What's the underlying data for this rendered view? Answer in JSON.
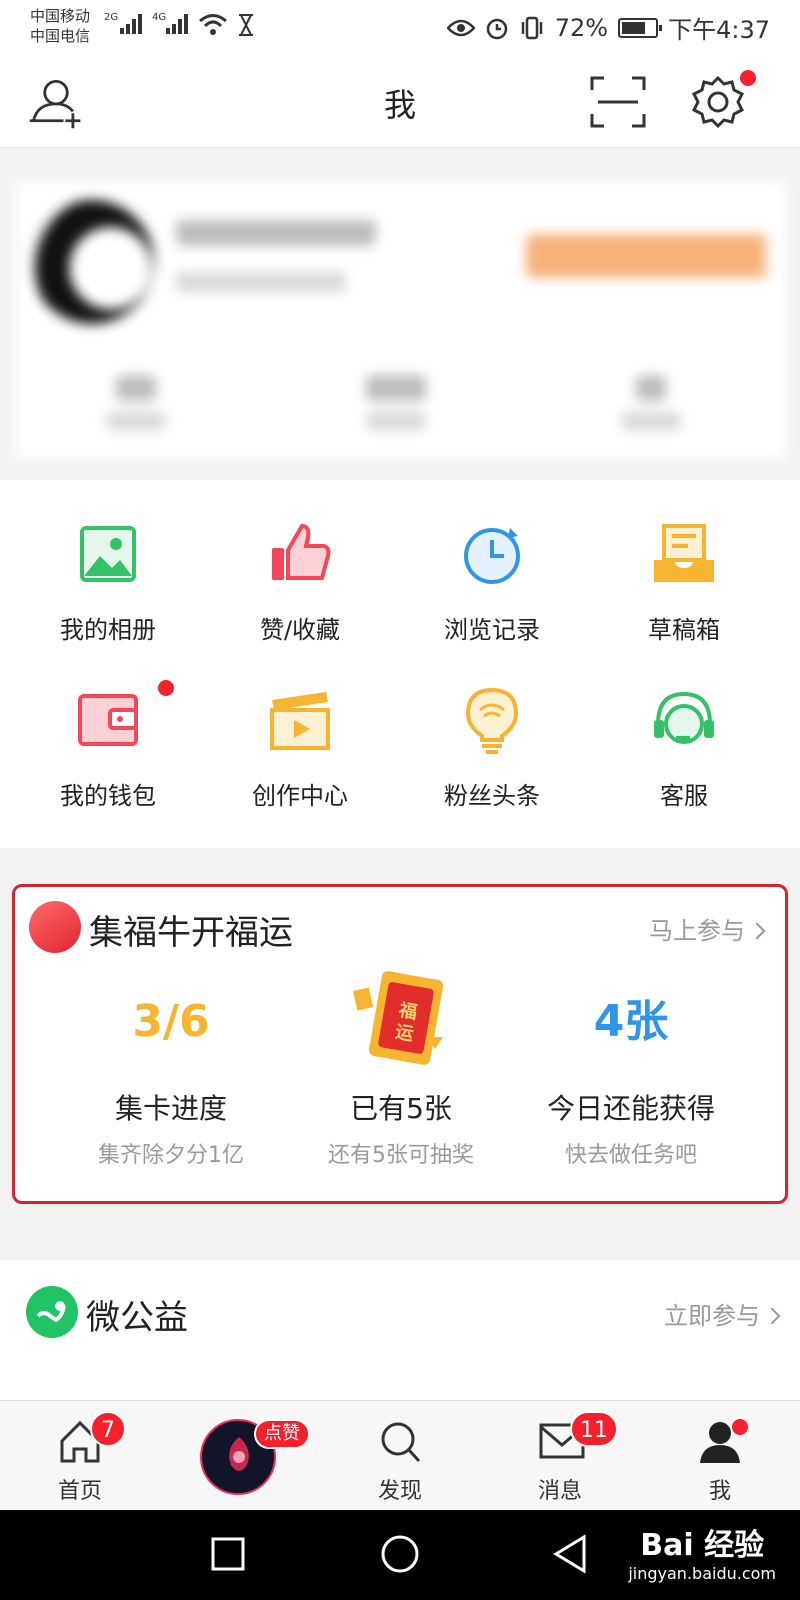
{
  "status_bar": {
    "carrier1": "中国移动",
    "carrier2": "中国电信",
    "net1": "2G",
    "net2": "4G",
    "battery": "72%",
    "battery_level": 0.72,
    "time": "下午4:37"
  },
  "header": {
    "title": "我"
  },
  "grid": {
    "items": [
      {
        "label": "我的相册",
        "icon": "photo-album-icon",
        "color": "#33c267"
      },
      {
        "label": "赞/收藏",
        "icon": "thumbs-up-icon",
        "color": "#f2485a"
      },
      {
        "label": "浏览记录",
        "icon": "clock-history-icon",
        "color": "#2f95e8"
      },
      {
        "label": "草稿箱",
        "icon": "draft-box-icon",
        "color": "#f6b431"
      },
      {
        "label": "我的钱包",
        "icon": "wallet-icon",
        "color": "#f2485a"
      },
      {
        "label": "创作中心",
        "icon": "video-clapper-icon",
        "color": "#f6b431"
      },
      {
        "label": "粉丝头条",
        "icon": "lightbulb-icon",
        "color": "#f6b431"
      },
      {
        "label": "客服",
        "icon": "headset-icon",
        "color": "#33c267"
      }
    ]
  },
  "jifu": {
    "title": "集福牛开福运",
    "more": "马上参与",
    "card_text": "福运",
    "stats": [
      {
        "big": "3/6",
        "label": "集卡进度",
        "sub": "集齐除夕分1亿",
        "color": "#f6b431"
      },
      {
        "big": "",
        "label": "已有5张",
        "sub": "还有5张可抽奖",
        "color": "#f6b431"
      },
      {
        "big": "4张",
        "label": "今日还能获得",
        "sub": "快去做任务吧",
        "color": "#2f95e8"
      }
    ]
  },
  "gongyi": {
    "title": "微公益",
    "more": "立即参与"
  },
  "tabbar": {
    "tabs": [
      {
        "label": "首页",
        "badge": "7"
      },
      {
        "label": "",
        "badge": "点赞"
      },
      {
        "label": "发现",
        "badge": ""
      },
      {
        "label": "消息",
        "badge": "11"
      },
      {
        "label": "我",
        "badge": ""
      }
    ]
  },
  "watermark": {
    "brand": "Bai 经验",
    "url": "jingyan.baidu.com"
  }
}
